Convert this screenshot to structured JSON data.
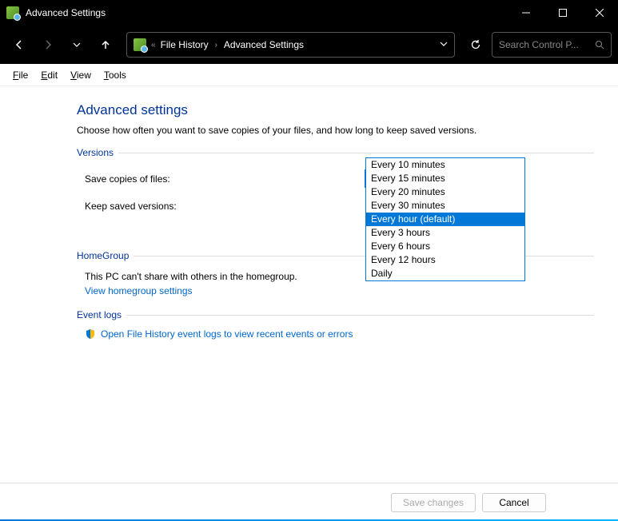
{
  "window": {
    "title": "Advanced Settings"
  },
  "nav": {
    "breadcrumb": {
      "root": "File History",
      "current": "Advanced Settings"
    },
    "search_placeholder": "Search Control P..."
  },
  "menus": {
    "file": "File",
    "edit": "Edit",
    "view": "View",
    "tools": "Tools"
  },
  "page": {
    "title": "Advanced settings",
    "description": "Choose how often you want to save copies of your files, and how long to keep saved versions."
  },
  "sections": {
    "versions": {
      "heading": "Versions",
      "save_label": "Save copies of files:",
      "save_value": "Every hour (default)",
      "keep_label": "Keep saved versions:",
      "options": [
        "Every 10 minutes",
        "Every 15 minutes",
        "Every 20 minutes",
        "Every 30 minutes",
        "Every hour (default)",
        "Every 3 hours",
        "Every 6 hours",
        "Every 12 hours",
        "Daily"
      ],
      "selected_index": 4
    },
    "homegroup": {
      "heading": "HomeGroup",
      "text": "This PC can't share with others in the homegroup.",
      "link": "View homegroup settings"
    },
    "eventlogs": {
      "heading": "Event logs",
      "link": "Open File History event logs to view recent events or errors"
    }
  },
  "footer": {
    "save": "Save changes",
    "cancel": "Cancel"
  }
}
